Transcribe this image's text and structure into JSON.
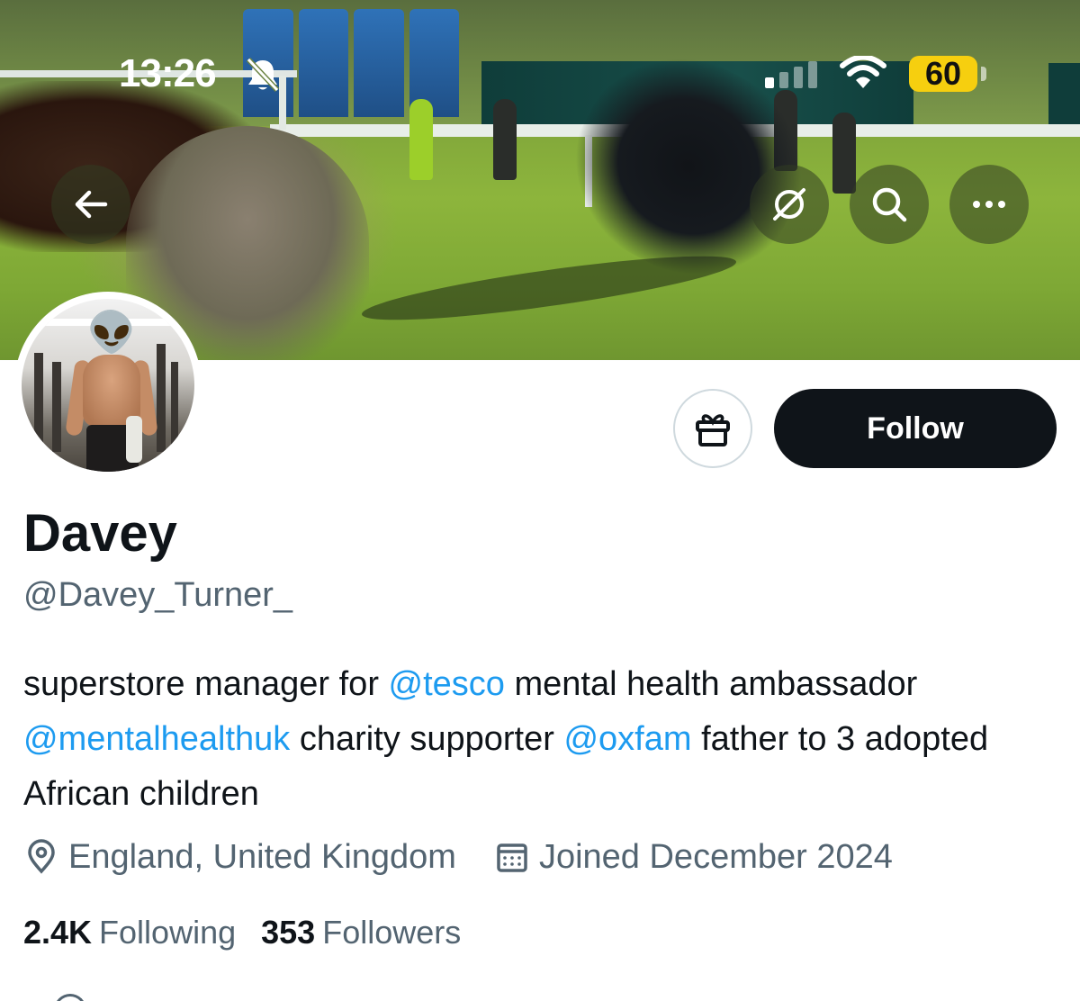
{
  "status_bar": {
    "time": "13:26",
    "battery": "60",
    "battery_color": "#f6cf0f",
    "icons": [
      "bell-slash-icon",
      "signal-icon",
      "wifi-icon",
      "battery-icon"
    ]
  },
  "header": {
    "icons": [
      "back-arrow-icon",
      "grok-icon",
      "search-icon",
      "more-icon"
    ]
  },
  "actions": {
    "gift_icon": "gift-icon",
    "follow_label": "Follow"
  },
  "profile": {
    "display_name": "Davey",
    "handle": "@Davey_Turner_",
    "bio": {
      "part1": "superstore manager for ",
      "mention1": "@tesco",
      "part2": " mental health ambassador ",
      "mention2": "@mentalhealthuk",
      "part3": " charity supporter ",
      "mention3": "@oxfam",
      "part4": " father to 3 adopted African children"
    },
    "location": "England, United Kingdom",
    "joined": "Joined December 2024",
    "following_count": "2.4K",
    "following_label": "Following",
    "followers_count": "353",
    "followers_label": "Followers"
  },
  "colors": {
    "mention": "#1d9bf0",
    "secondary_text": "#536471",
    "primary_text": "#0f1419",
    "follow_button": "#0f1419"
  }
}
